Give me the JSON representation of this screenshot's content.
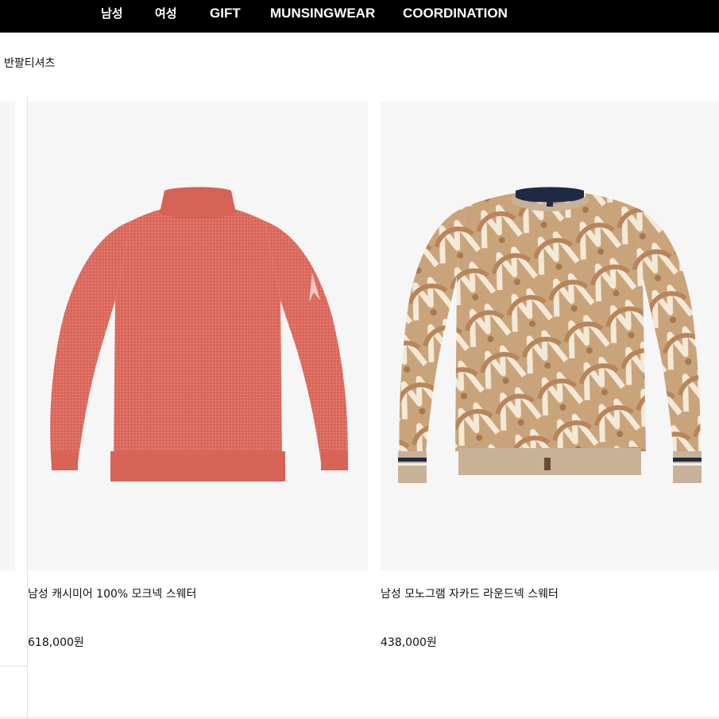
{
  "nav": {
    "items": [
      {
        "label": "남성"
      },
      {
        "label": "여성"
      },
      {
        "label": "GIFT"
      },
      {
        "label": "MUNSINGWEAR"
      },
      {
        "label": "COORDINATION"
      }
    ]
  },
  "category": {
    "label": "반팔티셔츠"
  },
  "products": [
    {
      "name": "남성 캐시미어 100% 모크넥 스웨터",
      "price": "618,000원",
      "image": "coral-mockneck-sweater",
      "color": "#dd6a5e"
    },
    {
      "name": "남성 모노그램 자카드 라운드넥 스웨터",
      "price": "438,000원",
      "image": "beige-monogram-jacquard-sweater",
      "color": "#c9a57c"
    }
  ],
  "colors": {
    "nav_bg": "#000000",
    "nav_text": "#ffffff",
    "card_bg": "#f6f6f6"
  }
}
